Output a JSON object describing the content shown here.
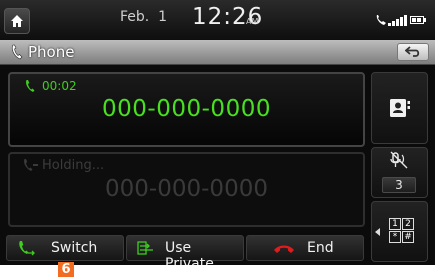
{
  "status_bar": {
    "date": "Feb.  1",
    "time": "12:26",
    "ampm": "AM",
    "icons": [
      "bluetooth-phone-icon",
      "signal-icon",
      "battery-icon"
    ]
  },
  "title_bar": {
    "title": "Phone",
    "icon": "phone-handset-icon",
    "back_icon": "back-arrow-icon"
  },
  "active_call": {
    "duration": "00:02",
    "number": "000-000-0000"
  },
  "held_call": {
    "status": "Holding...",
    "number": "000-000-0000"
  },
  "side_buttons": {
    "contacts_icon": "contacts-icon",
    "mic_icon": "mic-volume-icon",
    "mic_level": "3",
    "keypad_labels": [
      "1",
      "2",
      "*",
      "#"
    ]
  },
  "bottom_buttons": {
    "switch_label": "Switch",
    "private_label": "Use Private",
    "end_label": "End"
  },
  "marker_label": "6",
  "colors": {
    "call_green": "#49e022",
    "end_red": "#e11b1b",
    "marker_orange": "#f26d21"
  }
}
